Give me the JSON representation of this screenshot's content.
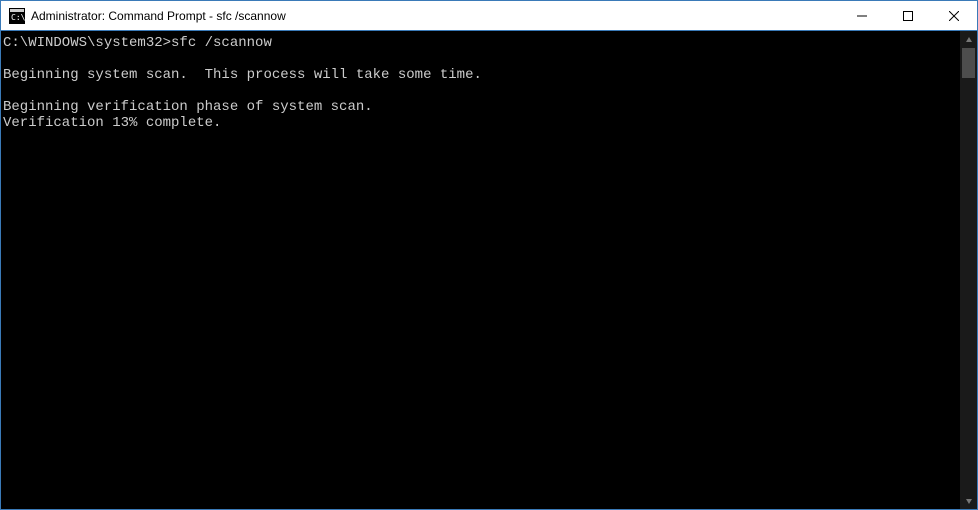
{
  "window": {
    "title": "Administrator: Command Prompt - sfc  /scannow"
  },
  "terminal": {
    "lines": [
      "C:\\WINDOWS\\system32>sfc /scannow",
      "",
      "Beginning system scan.  This process will take some time.",
      "",
      "Beginning verification phase of system scan.",
      "Verification 13% complete."
    ]
  }
}
